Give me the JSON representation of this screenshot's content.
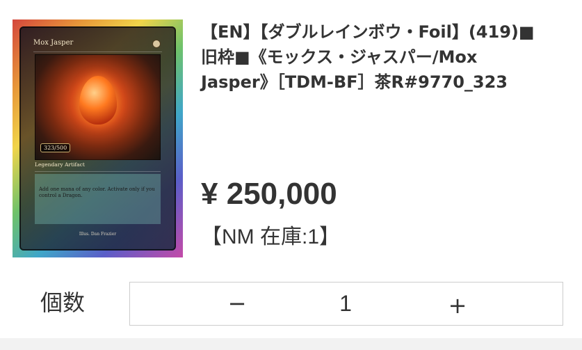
{
  "product": {
    "title": "【EN】【ダブルレインボウ・Foil】(419)■旧枠■《モックス・ジャスパー/Mox Jasper》［TDM-BF］茶R#9770_323",
    "price": "¥ 250,000",
    "stock": "【NM 在庫:1】"
  },
  "card_image": {
    "name": "Mox Jasper",
    "serial": "323/500",
    "type_line": "Legendary Artifact",
    "rules_text": "Add one mana of any color. Activate only if you control a Dragon.",
    "illustrator": "Illus. Dan Frazier"
  },
  "quantity": {
    "label": "個数",
    "minus_label": "−",
    "value": "1",
    "plus_label": "+"
  }
}
